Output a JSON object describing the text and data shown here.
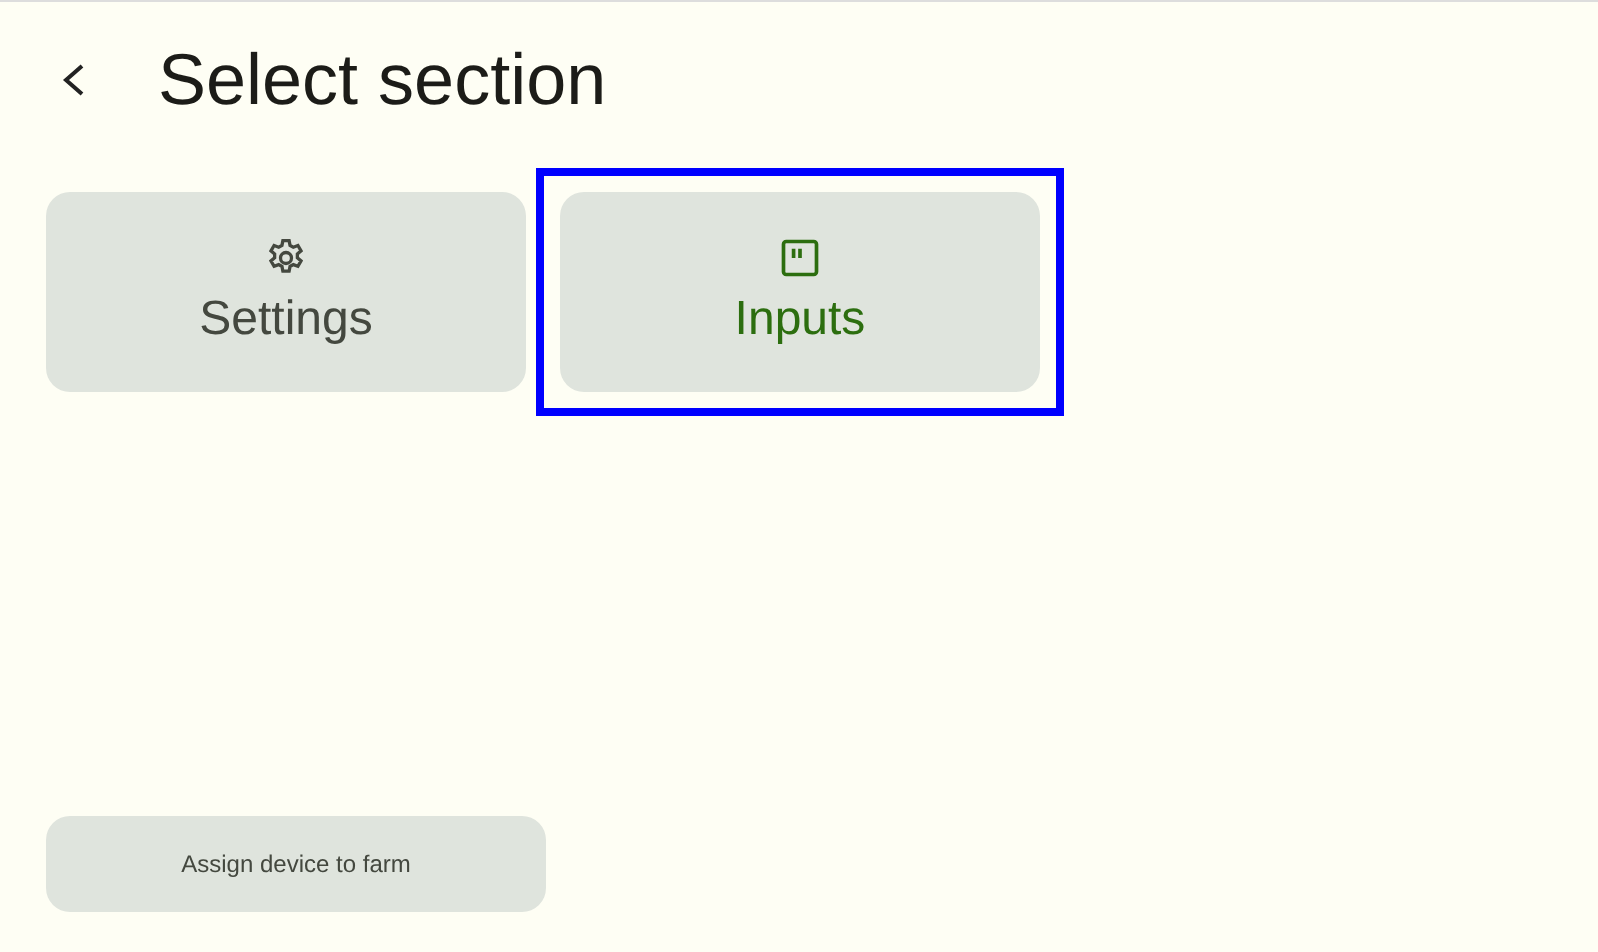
{
  "header": {
    "title": "Select section"
  },
  "sections": [
    {
      "kind": "settings",
      "label": "Settings",
      "selected": false
    },
    {
      "kind": "inputs",
      "label": "Inputs",
      "selected": true
    }
  ],
  "footer_button": {
    "label": "Assign device to farm"
  }
}
